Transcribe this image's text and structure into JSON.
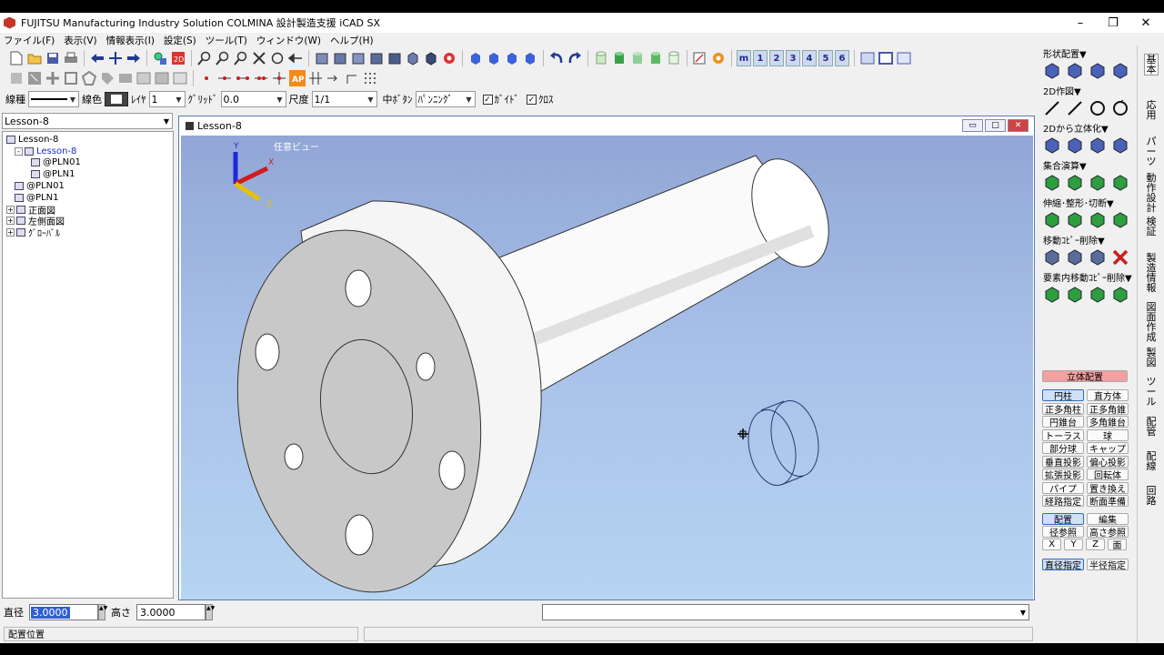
{
  "window": {
    "title": "FUJITSU Manufacturing Industry Solution COLMINA 設計製造支援 iCAD SX",
    "minimize": "–",
    "maximize": "❐",
    "close": "✕"
  },
  "menu": [
    "ファイル(F)",
    "表示(V)",
    "情報表示(I)",
    "設定(S)",
    "ツール(T)",
    "ウィンドウ(W)",
    "ヘルプ(H)"
  ],
  "toolbar1": {
    "view_numbers": [
      "m",
      "1",
      "2",
      "3",
      "4",
      "5",
      "6"
    ]
  },
  "options": {
    "line_type_label": "線種",
    "line_color_label": "線色",
    "layer_label": "ﾚｲﾔ",
    "layer_value": "1",
    "grid_label": "ｸﾞﾘｯﾄﾞ",
    "grid_value": "0.0",
    "scale_label": "尺度",
    "scale_value": "1/1",
    "middle_button_label": "中ﾎﾞﾀﾝ",
    "middle_button_value": "ﾊﾟﾝﾆﾝｸﾞ",
    "check_light": "ｶﾞｲﾄﾞ",
    "check_cross": "ｸﾛｽ",
    "check_mark": "✓"
  },
  "tree": {
    "selector_value": "Lesson-8",
    "nodes": [
      {
        "label": "Lesson-8",
        "indent": 0,
        "expander": "",
        "color": "#000000"
      },
      {
        "label": "Lesson-8",
        "indent": 1,
        "expander": "-",
        "color": "#1a2fc4"
      },
      {
        "label": "@PLN01",
        "indent": 3,
        "expander": "",
        "color": "#000000"
      },
      {
        "label": "@PLN1",
        "indent": 3,
        "expander": "",
        "color": "#000000"
      },
      {
        "label": "@PLN01",
        "indent": 1,
        "expander": "",
        "color": "#000000"
      },
      {
        "label": "@PLN1",
        "indent": 1,
        "expander": "",
        "color": "#000000"
      },
      {
        "label": "正面図",
        "indent": 0,
        "expander": "+",
        "color": "#000000"
      },
      {
        "label": "左側面図",
        "indent": 0,
        "expander": "+",
        "color": "#000000"
      },
      {
        "label": "ｸﾞﾛｰﾊﾞﾙ",
        "indent": 0,
        "expander": "+",
        "color": "#000000"
      }
    ]
  },
  "document": {
    "title": "Lesson-8",
    "view_label": "任意ビュー",
    "axes": {
      "x": "X",
      "y": "Y",
      "z": "Z"
    },
    "btn_min": "▭",
    "btn_max": "□",
    "btn_close": "✕"
  },
  "status": {
    "diameter_label": "直径",
    "diameter_value": "3.0000",
    "height_label": "高さ",
    "height_value": "3.0000",
    "message": "配置位置",
    "command_value": ""
  },
  "right_panel": {
    "sections": [
      {
        "title": "形状配置▼",
        "icons": [
          "cylinder-icon",
          "plate-icon",
          "box-icon",
          "cone-icon"
        ]
      },
      {
        "title": "2D作図▼",
        "icons": [
          "line-icon",
          "angle-icon",
          "circle-icon",
          "rotate-icon"
        ]
      },
      {
        "title": "2Dから立体化▼",
        "icons": [
          "extrude-icon",
          "revolve-icon",
          "sweep-icon",
          "loft-icon"
        ]
      },
      {
        "title": "集合演算▼",
        "icons": [
          "union-icon",
          "subtract-icon",
          "intersect-icon",
          "split-icon"
        ]
      },
      {
        "title": "伸縮･整形･切断▼",
        "icons": [
          "stretch-icon",
          "shape-icon",
          "cut-icon",
          "trim-icon"
        ]
      },
      {
        "title": "移動ｺﾋﾟｰ削除▼",
        "icons": [
          "move-icon",
          "copy-icon",
          "multi-copy-icon",
          "delete-icon"
        ]
      },
      {
        "title": "要素内移動ｺﾋﾟｰ削除▼",
        "icons": [
          "inner-move-icon",
          "inner-copy-icon",
          "inner-multi-icon",
          "inner-delete-icon"
        ]
      }
    ],
    "solid_header": "立体配置",
    "solid_buttons": [
      [
        "円柱",
        "直方体"
      ],
      [
        "正多角柱",
        "正多角錐"
      ],
      [
        "円錐台",
        "多角錐台"
      ],
      [
        "トーラス",
        "球"
      ],
      [
        "部分球",
        "キャップ"
      ],
      [
        "垂直投影",
        "偏心投影"
      ],
      [
        "拡張投影",
        "回転体"
      ],
      [
        "パイプ",
        "置き換え"
      ],
      [
        "経路指定",
        "断面準備"
      ]
    ],
    "place_buttons": [
      "配置",
      "編集"
    ],
    "ref_buttons": [
      "径参照",
      "高さ参照"
    ],
    "axis_buttons": [
      "X",
      "Y",
      "Z",
      "面"
    ],
    "mode_buttons": [
      "直径指定",
      "半径指定"
    ]
  },
  "right_tabs": [
    "基本",
    "応用",
    "パーツ",
    "動作設計",
    "検証",
    "製造情報",
    "図面作成",
    "製図",
    "ツール",
    "配管",
    "配線",
    "回路"
  ],
  "colors": {
    "accent": "#2f6bbf",
    "green_icon": "#2e9e3e",
    "delete_red": "#d01c1c",
    "solid_header_bg": "#f4a0a0"
  }
}
